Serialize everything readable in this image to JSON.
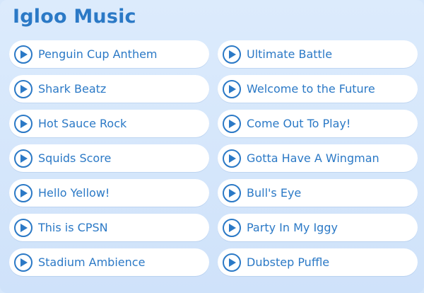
{
  "page": {
    "title": "Igloo Music"
  },
  "colors": {
    "accent": "#2b79c6",
    "background": "#d6e7fb",
    "button_bg": "#ffffff"
  },
  "icons": {
    "play": "play-icon"
  },
  "tracks_left": [
    {
      "label": "Penguin Cup Anthem"
    },
    {
      "label": "Shark Beatz"
    },
    {
      "label": "Hot Sauce Rock"
    },
    {
      "label": "Squids Score"
    },
    {
      "label": "Hello Yellow!"
    },
    {
      "label": "This is CPSN"
    },
    {
      "label": "Stadium Ambience"
    }
  ],
  "tracks_right": [
    {
      "label": "Ultimate Battle"
    },
    {
      "label": "Welcome to the Future"
    },
    {
      "label": "Come Out To Play!"
    },
    {
      "label": "Gotta Have A Wingman"
    },
    {
      "label": "Bull's Eye"
    },
    {
      "label": "Party In My Iggy"
    },
    {
      "label": "Dubstep Puffle"
    }
  ]
}
